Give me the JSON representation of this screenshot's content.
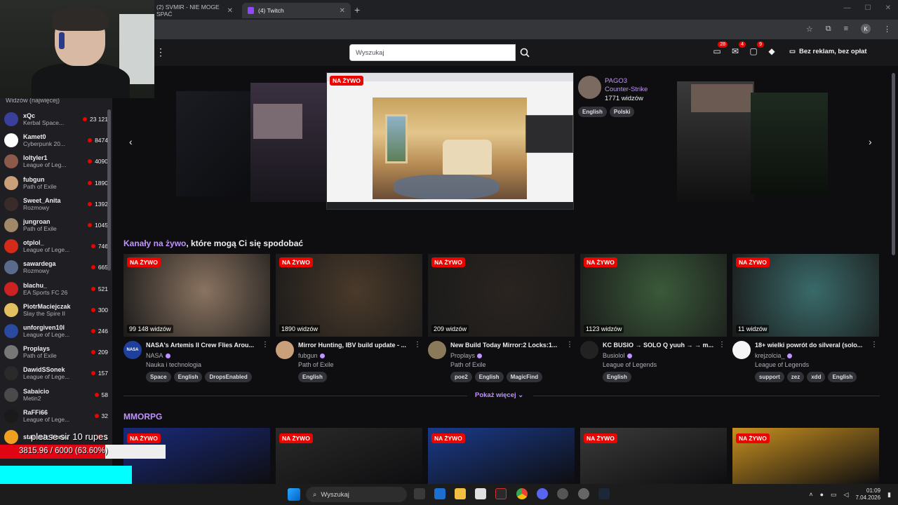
{
  "browser": {
    "tabs": [
      {
        "label": "(2) SVMIR - NIE MOGE SPAĆ"
      },
      {
        "label": "(4) Twitch"
      }
    ],
    "profile_initial": "K"
  },
  "topnav": {
    "search_placeholder": "Wyszukaj",
    "badges": {
      "notifications": "28",
      "inbox": "4",
      "whispers": "9"
    },
    "adfree_label": "Bez reklam, bez opłat"
  },
  "sidebar": {
    "header": "Widzów (najwięcej)",
    "channels": [
      {
        "name": "xQc",
        "category": "Kerbal Space...",
        "viewers": "23 121",
        "color": "#3a3f9b"
      },
      {
        "name": "Kamet0",
        "category": "Cyberpunk 20...",
        "viewers": "8474",
        "color": "#ffffff"
      },
      {
        "name": "loltyler1",
        "category": "League of Leg...",
        "viewers": "4090",
        "color": "#8b5a4a"
      },
      {
        "name": "fubgun",
        "category": "Path of Exile",
        "viewers": "1890",
        "color": "#c9a07a"
      },
      {
        "name": "Sweet_Anita",
        "category": "Rozmowy",
        "viewers": "1392",
        "color": "#3a2a2a"
      },
      {
        "name": "jungroan",
        "category": "Path of Exile",
        "viewers": "1045",
        "color": "#a08868"
      },
      {
        "name": "otplol_",
        "category": "League of Lege...",
        "viewers": "746",
        "color": "#d42a1a"
      },
      {
        "name": "sawardega",
        "category": "Rozmowy",
        "viewers": "665",
        "color": "#5a6a8a"
      },
      {
        "name": "blachu_",
        "category": "EA Sports FC 26",
        "viewers": "521",
        "color": "#cc2222"
      },
      {
        "name": "PiotrMaciejczak",
        "category": "Slay the Spire II",
        "viewers": "300",
        "color": "#e0c060"
      },
      {
        "name": "unforgiven10l",
        "category": "League of Lege...",
        "viewers": "246",
        "color": "#2a4aa0"
      },
      {
        "name": "Proplays",
        "category": "Path of Exile",
        "viewers": "209",
        "color": "#777777"
      },
      {
        "name": "DawidSSonek",
        "category": "League of Lege...",
        "viewers": "157",
        "color": "#2a2a2a"
      },
      {
        "name": "Sabaicio",
        "category": "Metin2",
        "viewers": "58",
        "color": "#4a4a4a"
      },
      {
        "name": "RaFFi66",
        "category": "League of Lege...",
        "viewers": "32",
        "color": "#1a1a1a"
      },
      {
        "name": "stanimir_borov",
        "category": "",
        "viewers": "1",
        "color": "#f0a020"
      }
    ]
  },
  "hero": {
    "live_label": "NA ŻYWO",
    "channel": "PAGO3",
    "game": "Counter-Strike",
    "viewers": "1771 widzów",
    "tags": [
      "English",
      "Polski"
    ]
  },
  "recommended": {
    "title_accent": "Kanały na żywo",
    "title_rest": ", które mogą Ci się spodobać",
    "cards": [
      {
        "live": "NA ŻYWO",
        "viewers": "99 148 widzów",
        "title": "NASA's Artemis II Crew Flies Arou...",
        "channel": "NASA",
        "category": "Nauka i technologia",
        "tags": [
          "Space",
          "English",
          "DropsEnabled"
        ],
        "thumb": "#8a7360",
        "avatar": "#1e3f9b",
        "avatar_text": "NASA"
      },
      {
        "live": "NA ŻYWO",
        "viewers": "1890 widzów",
        "title": "Mirror Hunting, IBV build update - ...",
        "channel": "fubgun",
        "category": "Path of Exile",
        "tags": [
          "English"
        ],
        "thumb": "#4a3a2a",
        "avatar": "#c9a07a",
        "avatar_text": ""
      },
      {
        "live": "NA ŻYWO",
        "viewers": "209 widzów",
        "title": "New Build Today Mirror:2 Locks:1...",
        "channel": "Proplays",
        "category": "Path of Exile",
        "tags": [
          "poe2",
          "English",
          "MagicFind"
        ],
        "thumb": "#2a2420",
        "avatar": "#8a7a5a",
        "avatar_text": ""
      },
      {
        "live": "NA ŻYWO",
        "viewers": "1123 widzów",
        "title": "KC BUSIO → SOLO Q yuuh → → m...",
        "channel": "Busiolol",
        "category": "League of Legends",
        "tags": [
          "English"
        ],
        "thumb": "#3a5a3a",
        "avatar": "#222222",
        "avatar_text": ""
      },
      {
        "live": "NA ŻYWO",
        "viewers": "11 widzów",
        "title": "18+ wielki powrót do silveral (solo...",
        "channel": "krejzolcia_",
        "category": "League of Legends",
        "tags": [
          "support",
          "zez",
          "xdd",
          "English"
        ],
        "thumb": "#3a6a6a",
        "avatar": "#f5f5f5",
        "avatar_text": ""
      }
    ],
    "show_more": "Pokaż więcej"
  },
  "mmorpg": {
    "title": "MMORPG",
    "cards": [
      {
        "live": "NA ŻYWO",
        "thumb": "#1a2a7a"
      },
      {
        "live": "NA ŻYWO",
        "thumb": "#2a2a2a"
      },
      {
        "live": "NA ŻYWO",
        "thumb": "#1a3a8a"
      },
      {
        "live": "NA ŻYWO",
        "thumb": "#3a3a3a"
      },
      {
        "live": "NA ŻYWO",
        "thumb": "#c89020"
      }
    ]
  },
  "donation": {
    "message": "please sir 10 rupes",
    "progress_label": "3815.96 / 6000 (63.60%)",
    "progress_fraction": 0.636
  },
  "taskbar": {
    "search_label": "Wyszukaj",
    "time": "01:09",
    "date": "7.04.2026"
  }
}
